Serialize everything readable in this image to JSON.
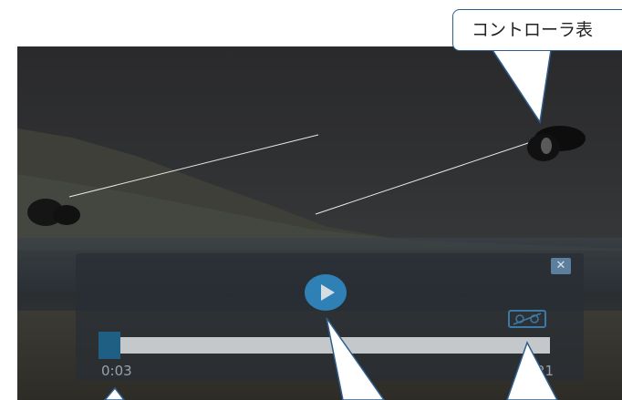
{
  "player": {
    "current_time": "0:03",
    "total_time_partial": "21",
    "progress_fraction": 0.01
  },
  "icons": {
    "play": "play-icon",
    "close": "close-icon",
    "vr": "vr-goggles-icon",
    "controller": "vr-controller-icon"
  },
  "callout": {
    "text": "コントローラ表"
  },
  "colors": {
    "accent": "#2f81b5",
    "callout_border": "#2f5f8f",
    "track": "#c5c8cb"
  }
}
